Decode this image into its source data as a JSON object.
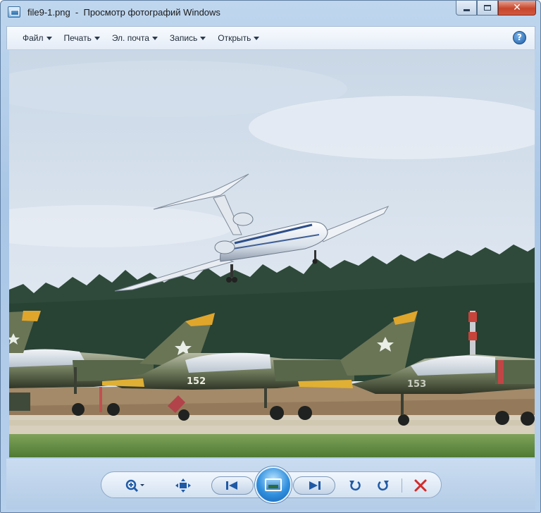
{
  "window": {
    "title": "file9-1.png  -  Просмотр фотографий Windows"
  },
  "menu": {
    "items": [
      {
        "label": "Файл"
      },
      {
        "label": "Печать"
      },
      {
        "label": "Эл. почта"
      },
      {
        "label": "Запись"
      },
      {
        "label": "Открыть"
      }
    ],
    "help_label": "?"
  },
  "photo": {
    "description_icon": "airliner-over-military-jets-photo",
    "tail_numbers": [
      "152",
      "153"
    ]
  },
  "controls": {
    "icons": [
      "zoom-icon",
      "fit-window-icon",
      "previous-icon",
      "slideshow-icon",
      "next-icon",
      "rotate-left-icon",
      "rotate-right-icon",
      "delete-icon"
    ]
  },
  "colors": {
    "accent": "#2f8fde",
    "close": "#c7462c",
    "delete": "#d42a2a"
  }
}
